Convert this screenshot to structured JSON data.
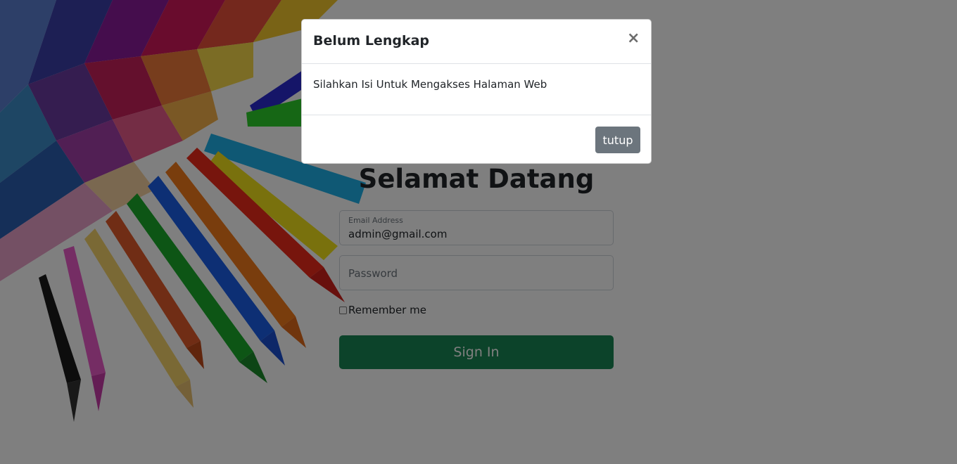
{
  "login": {
    "heading": "Selamat Datang",
    "email": {
      "label": "Email Address",
      "value": "admin@gmail.com"
    },
    "password": {
      "placeholder": "Password"
    },
    "remember_label": "Remember me",
    "signin_label": "Sign In"
  },
  "modal": {
    "title": "Belum Lengkap",
    "close_glyph": "×",
    "body": "Silahkan Isi Untuk Mengakses Halaman Web",
    "button_label": "tutup"
  },
  "colors": {
    "signin": "#198754",
    "secondary_button": "#6c757d",
    "backdrop": "rgba(0,0,0,0.5)"
  }
}
